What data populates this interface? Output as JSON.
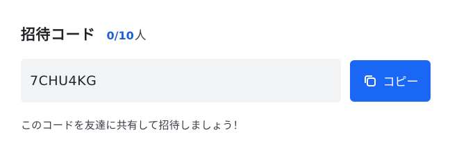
{
  "invite": {
    "title": "招待コード",
    "count_value": "0/10",
    "count_unit": "人",
    "code": "7CHU4KG",
    "copy_label": "コピー",
    "copy_icon": "copy-icon",
    "hint": "このコードを友達に共有して招待しましょう！"
  },
  "colors": {
    "accent": "#1a66f5",
    "count_text": "#1f5fd6",
    "field_bg": "#f2f3f5"
  }
}
